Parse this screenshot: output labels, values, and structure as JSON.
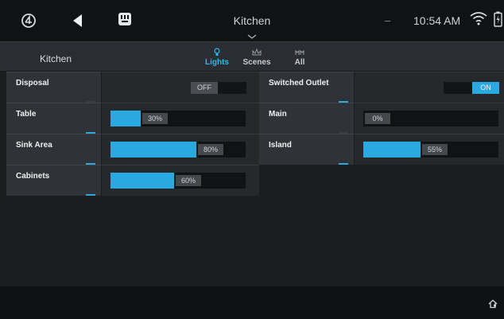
{
  "header": {
    "room_title": "Kitchen",
    "time": "10:54 AM",
    "dash": "–"
  },
  "subheader": {
    "room": "Kitchen"
  },
  "tabs": [
    {
      "label": "Lights",
      "icon": "lightbulb-icon",
      "active": true
    },
    {
      "label": "Scenes",
      "icon": "scenes-icon",
      "active": false
    },
    {
      "label": "All",
      "icon": "all-icon",
      "active": false
    }
  ],
  "loads": [
    {
      "name": "Disposal",
      "type": "toggle",
      "value_label": "OFF",
      "state": "off"
    },
    {
      "name": "Switched Outlet",
      "type": "toggle",
      "value_label": "ON",
      "state": "on"
    },
    {
      "name": "Table",
      "type": "dimmer",
      "value_label": "30%",
      "level": 30
    },
    {
      "name": "Main",
      "type": "dimmer",
      "value_label": "0%",
      "level": 0
    },
    {
      "name": "Sink Area",
      "type": "dimmer",
      "value_label": "80%",
      "level": 80
    },
    {
      "name": "Island",
      "type": "dimmer",
      "value_label": "55%",
      "level": 55
    },
    {
      "name": "Cabinets",
      "type": "dimmer",
      "value_label": "60%",
      "level": 60
    }
  ],
  "colors": {
    "accent": "#2aa9e0",
    "active_tab": "#2fb8ec",
    "off_indicator": "#3a3d40"
  }
}
